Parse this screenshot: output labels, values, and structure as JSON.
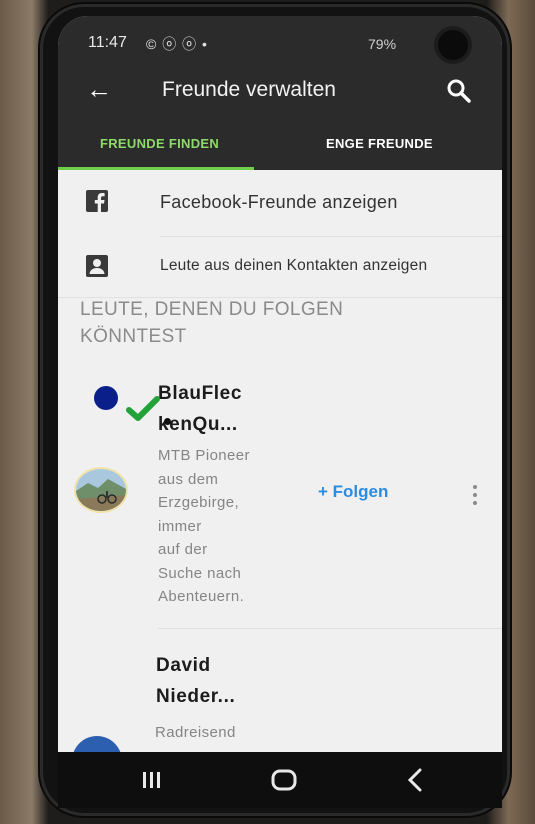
{
  "status_bar": {
    "time": "11:47",
    "notification_icons": "© ⓞ ⓞ •",
    "battery": "79%"
  },
  "app_bar": {
    "title": "Freunde verwalten",
    "back_icon": "arrow-left-icon",
    "search_icon": "search-icon"
  },
  "tabs": [
    {
      "label": "FREUNDE FINDEN",
      "active": true
    },
    {
      "label": "ENGE FREUNDE",
      "active": false
    }
  ],
  "options": [
    {
      "icon": "facebook-icon",
      "label": "Facebook-Freunde anzeigen"
    },
    {
      "icon": "contact-icon",
      "label": "Leute aus deinen Kontakten anzeigen"
    }
  ],
  "section": {
    "title": "LEUTE, DENEN DU FOLGEN KÖNNTEST"
  },
  "suggestions": [
    {
      "name_line1": "BlauFlec",
      "name_line2": "kenQu...",
      "bio_lines": [
        "MTB Pioneer",
        "aus dem",
        "Erzgebirge,",
        "immer",
        "auf der",
        "Suche nach",
        "Abenteuern."
      ],
      "follow_label": "+ Folgen"
    },
    {
      "name_line1": "David",
      "name_line2": "Nieder...",
      "bio_lines": [
        "Radreisend"
      ]
    }
  ],
  "colors": {
    "accent_green": "#6fcf4a",
    "follow_blue": "#2d8be0",
    "overlay_dot": "#0b1f8a",
    "overlay_check": "#23a23a"
  }
}
